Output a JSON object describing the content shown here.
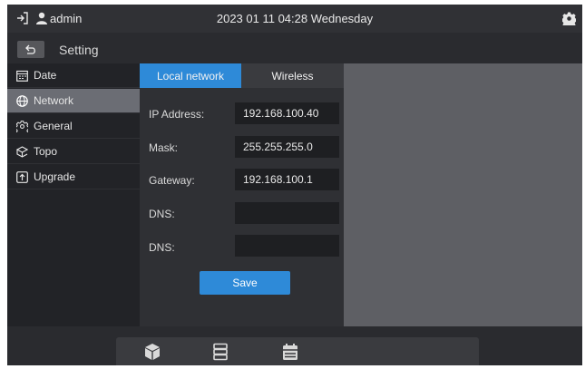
{
  "topbar": {
    "username": "admin",
    "datetime": "2023 01 11 04:28 Wednesday",
    "icons": [
      "logout-icon",
      "user-icon",
      "settings-gear-icon"
    ]
  },
  "header": {
    "title": "Setting",
    "back_icon": "back-arrow-icon"
  },
  "sidebar": {
    "items": [
      {
        "label": "Date",
        "icon": "calendar-icon",
        "active": false
      },
      {
        "label": "Network",
        "icon": "globe-icon",
        "active": true
      },
      {
        "label": "General",
        "icon": "gear-icon",
        "active": false
      },
      {
        "label": "Topo",
        "icon": "topology-icon",
        "active": false
      },
      {
        "label": "Upgrade",
        "icon": "upgrade-icon",
        "active": false
      }
    ]
  },
  "tabs": {
    "local": "Local network",
    "wireless": "Wireless"
  },
  "form": {
    "ip_label": "IP Address:",
    "ip_value": "192.168.100.40",
    "mask_label": "Mask:",
    "mask_value": "255.255.255.0",
    "gateway_label": "Gateway:",
    "gateway_value": "192.168.100.1",
    "dns1_label": "DNS:",
    "dns1_value": "",
    "dns2_label": "DNS:",
    "dns2_value": "",
    "save_label": "Save"
  },
  "dock": {
    "icons": [
      "cube-icon",
      "server-list-icon",
      "calendar-icon"
    ]
  },
  "colors": {
    "accent": "#2e8ad8",
    "sidebar_active": "#6b6d74",
    "background": "#2a2b2f"
  }
}
